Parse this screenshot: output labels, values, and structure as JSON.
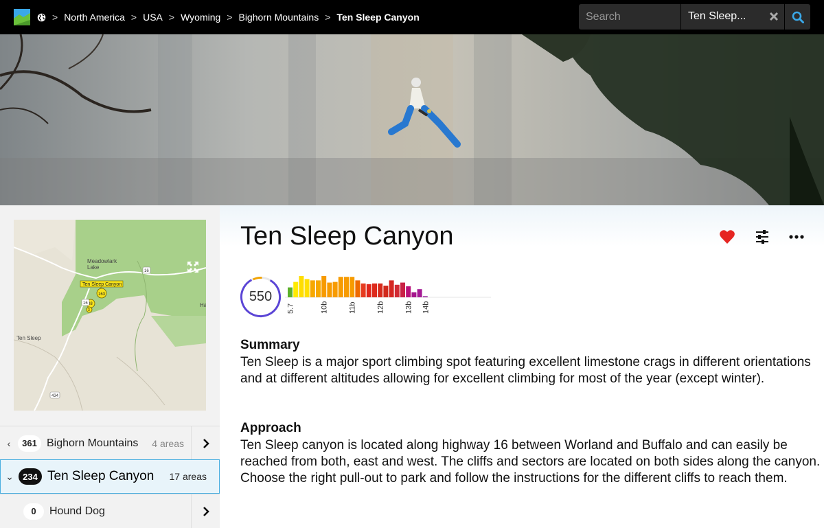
{
  "header": {
    "breadcrumbs": [
      {
        "label": "North America"
      },
      {
        "label": "USA"
      },
      {
        "label": "Wyoming"
      },
      {
        "label": "Bighorn Mountains"
      },
      {
        "label": "Ten Sleep Canyon"
      }
    ],
    "separator": ">",
    "search": {
      "placeholder": "Search",
      "value": ""
    },
    "location": {
      "value": "Ten Sleep..."
    },
    "icons": {
      "logo": "logo-icon",
      "globe": "globe-icon",
      "clear": "close-icon",
      "search": "search-icon"
    }
  },
  "map": {
    "labels": {
      "lake": "Meadowlark Lake",
      "marker_label": "Ten Sleep Canyon",
      "town": "Ten Sleep",
      "edge": "Ha"
    },
    "markers": [
      "163",
      "38",
      "3"
    ],
    "road_shields": [
      "16",
      "16",
      "434"
    ]
  },
  "sidebar": {
    "parent": {
      "chevron": "‹",
      "count": "361",
      "name": "Bighorn Mountains",
      "sub": "4 areas"
    },
    "current": {
      "chevron": "⌄",
      "count": "234",
      "name": "Ten Sleep Canyon",
      "sub": "17 areas"
    },
    "child": {
      "count": "0",
      "name": "Hound Dog"
    }
  },
  "main": {
    "title": "Ten Sleep Canyon",
    "score": "550",
    "actions": {
      "favorite": "heart-icon",
      "filter": "sliders-icon",
      "more": "more-icon"
    },
    "summary_heading": "Summary",
    "summary": "Ten Sleep is a major sport climbing spot featuring excellent limestone crags in different orientations and at different altitudes allowing for excellent climbing for most of the year (except winter).",
    "approach_heading": "Approach",
    "approach": "Ten Sleep canyon is located along highway 16 between Worland and Buffalo and can easily be reached from both, east and west. The cliffs and sectors are located on both sides along the canyon. Choose the right pull-out to park and follow the instructions for the different cliffs to reach them."
  },
  "chart_data": {
    "type": "bar",
    "tick_labels": [
      "5.7",
      "10b",
      "11b",
      "12b",
      "13b",
      "14b"
    ],
    "values": [
      0.45,
      0.7,
      0.97,
      0.83,
      0.77,
      0.77,
      0.97,
      0.67,
      0.7,
      0.93,
      0.93,
      0.93,
      0.77,
      0.63,
      0.6,
      0.63,
      0.63,
      0.53,
      0.77,
      0.57,
      0.67,
      0.5,
      0.23,
      0.37,
      0.03
    ],
    "colors": [
      "#5bb02a",
      "#ffea00",
      "#ffdd00",
      "#ffe000",
      "#f7a800",
      "#f7a800",
      "#f79b00",
      "#f79b00",
      "#f79b00",
      "#f79b00",
      "#f79b00",
      "#f79b00",
      "#ee6a00",
      "#e63b1f",
      "#e0261b",
      "#dd2a1c",
      "#d72a1b",
      "#d12a1c",
      "#d52620",
      "#d12a33",
      "#c92245",
      "#b8127a",
      "#a5158c",
      "#a51a95",
      "#8a1190"
    ]
  },
  "colors": {
    "accent": "#48aee0",
    "heart": "#e62622",
    "ring": "#5b45d6",
    "search_icon": "#3aa8e8"
  }
}
